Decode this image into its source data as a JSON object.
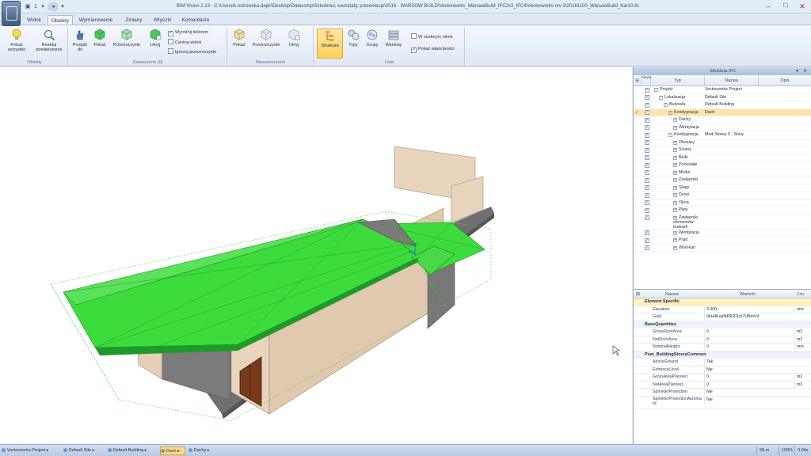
{
  "window": {
    "title": "BIM Vision 2.13 - C:\\Users\\k.ostrowska-dajer\\Desktop\\Datacomp\\Szkolenia, warsztaty, prezentacje\\2016 - WARSOW BUILD\\Vectorworks_WarsawBuild_IFC2x3_IFC4\\Vectorworks rev 3\\20161100_WarsawBuild_Kar10.ifc",
    "quick_access_value": "1",
    "minimize": "–",
    "maximize": "☐",
    "close": "✕"
  },
  "tabs": [
    "Widok",
    "Obiekty",
    "Wymiarowanie",
    "Zmiany",
    "Wtyczki",
    "Komentarze"
  ],
  "active_tab": "Obiekty",
  "ribbon": {
    "groups": [
      {
        "label": "Obiekty",
        "buttons": [
          "Pokaż wszystko",
          "Resetuj powiększenie"
        ]
      },
      {
        "label": "Zaznaczone (0)",
        "buttons": [
          "Przejdź do",
          "Pokaż",
          "Przezroczyste",
          "Ukryj"
        ],
        "checks": [
          {
            "label": "Wyróżnij kolorem",
            "checked": true
          },
          {
            "label": "Centruj widok",
            "checked": false
          },
          {
            "label": "Ignoruj przezroczyste",
            "checked": false
          }
        ]
      },
      {
        "label": "Niezaznaczone",
        "buttons": [
          "Pokaż",
          "Przezroczyste",
          "Ukryj"
        ]
      },
      {
        "label": "Lista",
        "buttons": [
          "Struktura",
          "Typy",
          "Grupy",
          "Warstwy"
        ],
        "checks": [
          {
            "label": "W osobnym oknie",
            "checked": false
          },
          {
            "label": "Pokaż właściwości",
            "checked": true
          }
        ]
      }
    ]
  },
  "panel": {
    "title": "Struktura IFC",
    "pin": "▾",
    "close": "✕",
    "columns": {
      "active": "Aktywny",
      "type": "Typ",
      "name": "Nazwa",
      "desc": "Opis"
    },
    "tree": [
      {
        "type": "Projekt",
        "name": "Vectorworks Project",
        "level": 0,
        "exp": "−",
        "active": true
      },
      {
        "type": "Lokalizacja",
        "name": "Default Site",
        "level": 1,
        "exp": "−",
        "active": true
      },
      {
        "type": "Budowla",
        "name": "Default Building",
        "level": 2,
        "exp": "−",
        "active": true
      },
      {
        "type": "Kondygnacja",
        "name": "Dach",
        "level": 3,
        "exp": "−",
        "active": true,
        "selected": true
      },
      {
        "type": "Dachy",
        "name": "",
        "level": 4,
        "exp": "+",
        "active": true
      },
      {
        "type": "Wentylacja",
        "name": "",
        "level": 4,
        "exp": "+",
        "active": true
      },
      {
        "type": "Kondygnacja",
        "name": "Mod-Storey 0 - Story",
        "level": 3,
        "exp": "−",
        "active": true
      },
      {
        "type": "Obszary",
        "name": "",
        "level": 4,
        "exp": "+",
        "active": true
      },
      {
        "type": "Ściany",
        "name": "",
        "level": 4,
        "exp": "+",
        "active": true
      },
      {
        "type": "Belki",
        "name": "",
        "level": 4,
        "exp": "+",
        "active": true
      },
      {
        "type": "Pozostałe",
        "name": "",
        "level": 4,
        "exp": "+",
        "active": true
      },
      {
        "type": "Meble",
        "name": "",
        "level": 4,
        "exp": "+",
        "active": true
      },
      {
        "type": "Zastępniki",
        "name": "",
        "level": 4,
        "exp": "+",
        "active": true
      },
      {
        "type": "Słupy",
        "name": "",
        "level": 4,
        "exp": "+",
        "active": true
      },
      {
        "type": "Drzwi",
        "name": "",
        "level": 4,
        "exp": "+",
        "active": true
      },
      {
        "type": "Okna",
        "name": "",
        "level": 4,
        "exp": "+",
        "active": true
      },
      {
        "type": "Płyty",
        "name": "",
        "level": 4,
        "exp": "+",
        "active": true
      },
      {
        "type": "Zastępniki elementów budowli",
        "name": "",
        "level": 4,
        "exp": "+",
        "active": true,
        "tall": true
      },
      {
        "type": "Wentylacja",
        "name": "",
        "level": 4,
        "exp": "+",
        "active": true
      },
      {
        "type": "Prąd",
        "name": "",
        "level": 4,
        "exp": "+",
        "active": true
      },
      {
        "type": "Wod-kan",
        "name": "",
        "level": 4,
        "exp": "+",
        "active": true
      }
    ],
    "props_columns": {
      "name": "Nazwa",
      "value": "Wartość",
      "unit": "J.m."
    },
    "props": [
      {
        "category": "Element Specific",
        "highlight": true
      },
      {
        "key": "Elevation",
        "value": "3.000",
        "unit": "mm"
      },
      {
        "key": "Guid",
        "value": "0kH4Kup9tPA2DUn7UBmVd",
        "unit": ""
      },
      {
        "category": "BaseQuantities"
      },
      {
        "key": "GrossFloorArea",
        "value": "0",
        "unit": "m2"
      },
      {
        "key": "NetFloorArea",
        "value": "0",
        "unit": "m2"
      },
      {
        "key": "NominalHeight",
        "value": "0",
        "unit": "mm"
      },
      {
        "category": "Pset_BuildingStoreyCommon"
      },
      {
        "key": "AboveGround",
        "value": "Tak",
        "unit": ""
      },
      {
        "key": "EntranceLevel",
        "value": "Nie",
        "unit": ""
      },
      {
        "key": "GrossAreaPlanned",
        "value": "0",
        "unit": "m2"
      },
      {
        "key": "NetAreaPlanned",
        "value": "0",
        "unit": "m2"
      },
      {
        "key": "SprinklerProtection",
        "value": "Nie",
        "unit": ""
      },
      {
        "key": "SprinklerProtectionAutomatic",
        "value": "Nie",
        "unit": ""
      }
    ]
  },
  "statusbar": {
    "crumbs": [
      "Vectorworks Project",
      "Default Site",
      "Default Building",
      "Dach",
      "Dachy"
    ],
    "selected_crumb": "Dach",
    "scale": "58 m",
    "zoom": "100%",
    "fps": "0.04s"
  },
  "colors": {
    "roof": "#3ddc3d",
    "wall": "#e8d4bd",
    "wall_dark": "#7a7a7a",
    "slab": "#6e6e6e",
    "door": "#7a3a1a",
    "accent": "#ffcf5a"
  }
}
